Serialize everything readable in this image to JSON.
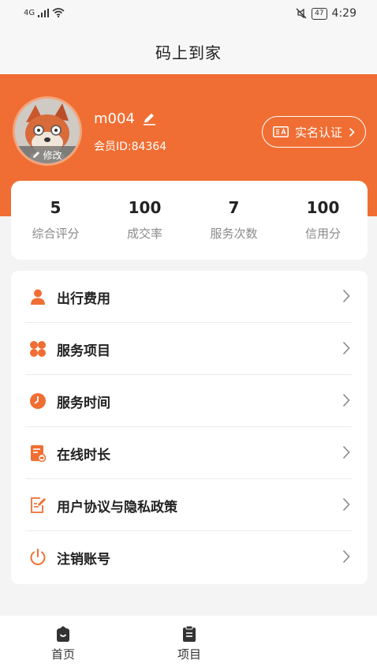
{
  "status_bar": {
    "network": "4G",
    "battery": "47",
    "time": "4:29"
  },
  "nav": {
    "title": "码上到家"
  },
  "profile": {
    "avatar_edit_label": "修改",
    "username": "m004",
    "member_id": "会员ID:84364",
    "verify_label": "实名认证",
    "verify_badge": "ΞA"
  },
  "stats": [
    {
      "value": "5",
      "label": "综合评分"
    },
    {
      "value": "100",
      "label": "成交率"
    },
    {
      "value": "7",
      "label": "服务次数"
    },
    {
      "value": "100",
      "label": "信用分"
    }
  ],
  "menu": [
    {
      "label": "出行费用",
      "icon": "person-icon"
    },
    {
      "label": "服务项目",
      "icon": "grid-icon"
    },
    {
      "label": "服务时间",
      "icon": "clock-icon"
    },
    {
      "label": "在线时长",
      "icon": "document-icon"
    },
    {
      "label": "用户协议与隐私政策",
      "icon": "edit-document-icon"
    },
    {
      "label": "注销账号",
      "icon": "power-icon"
    }
  ],
  "tabs": [
    {
      "label": "首页",
      "icon": "home-bag-icon"
    },
    {
      "label": "项目",
      "icon": "clipboard-icon"
    }
  ],
  "colors": {
    "accent": "#f06e33",
    "background": "#f4f4f4"
  }
}
